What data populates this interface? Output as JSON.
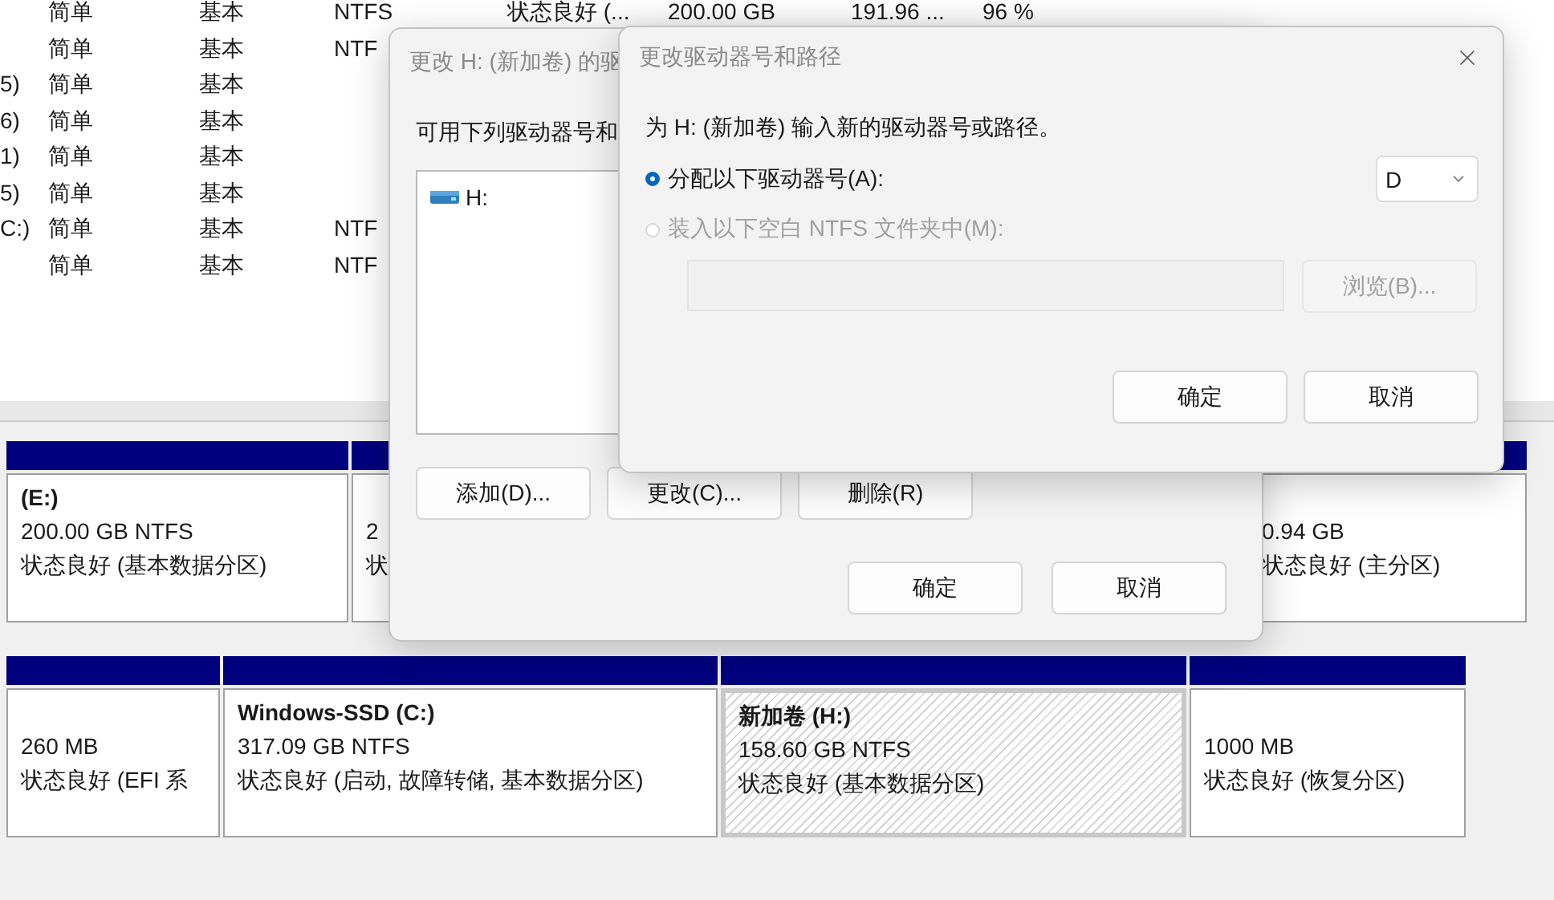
{
  "volume_list": {
    "rows": [
      {
        "cells": [
          "",
          "简单",
          "基本",
          "NTFS",
          "状态良好 (...",
          "200.00 GB",
          "191.96 ...",
          "96 %"
        ]
      },
      {
        "cells": [
          "",
          "简单",
          "基本",
          "NTF"
        ]
      },
      {
        "cells": [
          "5)",
          "简单",
          "基本"
        ]
      },
      {
        "cells": [
          "6)",
          "简单",
          "基本"
        ]
      },
      {
        "cells": [
          "1)",
          "简单",
          "基本"
        ]
      },
      {
        "cells": [
          "5)",
          "简单",
          "基本"
        ]
      },
      {
        "cells": [
          "C:)",
          "简单",
          "基本",
          "NTF"
        ]
      },
      {
        "cells": [
          "",
          "简单",
          "基本",
          "NTF"
        ]
      }
    ]
  },
  "disk_map": {
    "disks": [
      {
        "partitions": [
          {
            "name": "(E:)",
            "size": "200.00 GB NTFS",
            "status": "状态良好 (基本数据分区)",
            "selected": false
          },
          {
            "size": "2",
            "status": "状",
            "selected": false
          },
          {
            "size": "0.94 GB",
            "status": "状态良好 (主分区)",
            "selected": false
          }
        ]
      },
      {
        "partitions": [
          {
            "size": "260 MB",
            "status": "状态良好 (EFI 系",
            "selected": false
          },
          {
            "name": "Windows-SSD  (C:)",
            "size": "317.09 GB NTFS",
            "status": "状态良好 (启动, 故障转储, 基本数据分区)",
            "selected": false
          },
          {
            "name": "新加卷  (H:)",
            "size": "158.60 GB NTFS",
            "status": "状态良好 (基本数据分区)",
            "selected": true
          },
          {
            "size": "1000 MB",
            "status": "状态良好 (恢复分区)",
            "selected": false
          }
        ]
      }
    ]
  },
  "letter_dialog": {
    "title": "更改 H: (新加卷) 的驱",
    "label": "可用下列驱动器号和",
    "list_items": [
      {
        "label": "H:"
      }
    ],
    "buttons": [
      "添加(D)...",
      "更改(C)...",
      "删除(R)"
    ],
    "footer_buttons": [
      "确定",
      "取消"
    ]
  },
  "change_dialog": {
    "title": "更改驱动器号和路径",
    "prompt": "为 H: (新加卷) 输入新的驱动器号或路径。",
    "options": [
      {
        "kind": "letter",
        "label": "分配以下驱动器号(A):",
        "selected": true,
        "disabled": false
      },
      {
        "kind": "folder",
        "label": "装入以下空白 NTFS 文件夹中(M):",
        "selected": false,
        "disabled": true
      }
    ],
    "letter_select": {
      "value": "D"
    },
    "folder_field": {
      "disabled": true
    },
    "browse_button": {
      "label": "浏览(B)...",
      "disabled": true
    },
    "footer_buttons": [
      "确定",
      "取消"
    ]
  }
}
